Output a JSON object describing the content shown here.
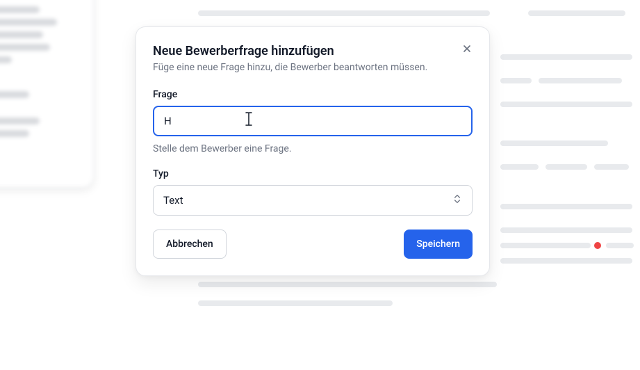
{
  "modal": {
    "title": "Neue Bewerberfrage hinzufügen",
    "subtitle": "Füge eine neue Frage hinzu, die Bewerber beantworten müssen.",
    "question": {
      "label": "Frage",
      "value": "H",
      "help": "Stelle dem Bewerber eine Frage."
    },
    "type": {
      "label": "Typ",
      "selected": "Text"
    },
    "actions": {
      "cancel": "Abbrechen",
      "save": "Speichern"
    }
  }
}
